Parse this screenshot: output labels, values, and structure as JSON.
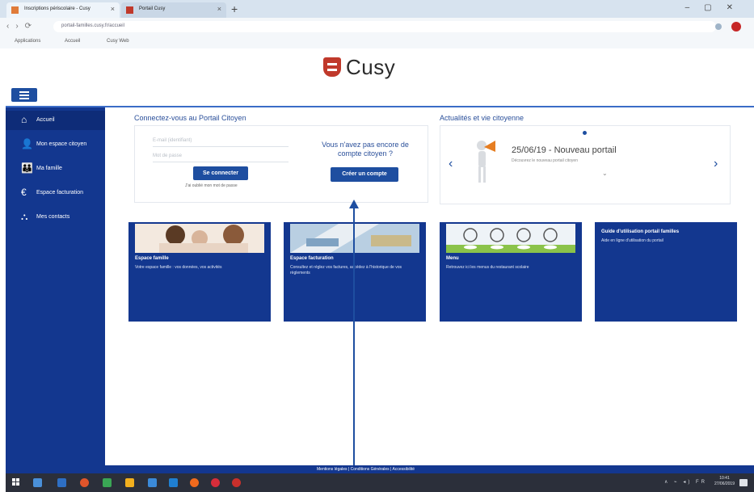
{
  "browser": {
    "tabs": [
      {
        "label": "Inscriptions périscolaire - Cusy"
      },
      {
        "label": "Portail Cusy"
      }
    ],
    "new_tab": "+",
    "url": "portail-familles.cusy.fr/accueil",
    "bookmarks": [
      "Applications",
      "Accueil",
      "Cusy Web"
    ]
  },
  "site": {
    "logo_text": "Cusy",
    "brand_color": "#13378f",
    "accent_color": "#c0392b"
  },
  "sidebar": {
    "items": [
      {
        "label": "Accueil",
        "icon": "home-icon",
        "glyph": "⌂"
      },
      {
        "label": "Mon espace citoyen",
        "icon": "person-icon",
        "glyph": "👤"
      },
      {
        "label": "Ma famille",
        "icon": "family-icon",
        "glyph": "👪"
      },
      {
        "label": "Espace facturation",
        "icon": "euro-icon",
        "glyph": "€"
      },
      {
        "label": "Mes contacts",
        "icon": "sitemap-icon",
        "glyph": "⛬"
      }
    ]
  },
  "login": {
    "title": "Connectez-vous au Portail Citoyen",
    "email_placeholder": "E-mail (identifiant)",
    "password_placeholder": "Mot de passe",
    "connect_button": "Se connecter",
    "forgot_link": "J'ai oublié mon mot de passe",
    "no_account_text": "Vous n'avez pas encore de compte citoyen ?",
    "create_button": "Créer un compte"
  },
  "news": {
    "title": "Actualités et vie citoyenne",
    "prev": "‹",
    "next": "›",
    "item_title": "25/06/19 - Nouveau portail",
    "item_sub": "Découvrez le nouveau portail citoyen",
    "more": "⌄"
  },
  "cards": [
    {
      "title": "Espace famille",
      "desc": "Votre espace famille : vos données, vos activités"
    },
    {
      "title": "Espace facturation",
      "desc": "Consultez et réglez vos factures, accédez à l'historique de vos règlements"
    },
    {
      "title": "Menu",
      "desc": "Retrouvez ici les menus du restaurant scolaire"
    },
    {
      "title": "Guide d'utilisation portail familles",
      "desc": "Aide en ligne d'utilisation du portail"
    }
  ],
  "footer": {
    "links": "Mentions légales | Conditions Générales | Accessibilité"
  },
  "taskbar": {
    "tray": "∧ ⌁ ◂) FR",
    "time": "10:41",
    "date": "27/06/2019"
  }
}
